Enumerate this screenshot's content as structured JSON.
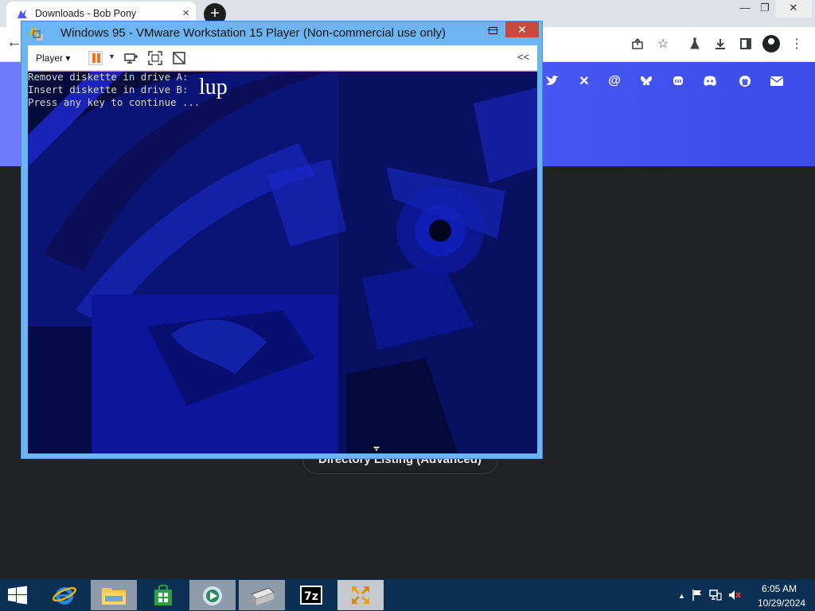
{
  "browser": {
    "tab_title": "Downloads - Bob Pony",
    "tab_close": "×",
    "new_tab": "+",
    "win_min": "—",
    "win_max": "❐",
    "win_close": "✕"
  },
  "site": {
    "directory_listing_label": "Directory Listing (Advanced)",
    "social_icons": [
      "twitter-icon",
      "x-icon",
      "threads-icon",
      "bluesky-icon",
      "mastodon-icon",
      "discord-icon",
      "github-icon",
      "email-icon"
    ]
  },
  "vmware": {
    "title": "Windows 95 - VMware Workstation 15 Player (Non-commercial use only)",
    "player_menu": "Player ▾",
    "collapse": "<<",
    "minimize": "—",
    "close": "✕",
    "boot_lines": [
      "Remove diskette in drive A:",
      "Insert diskette in drive B:",
      "Press any key to continue ..."
    ],
    "overlay_text": "lup"
  },
  "taskbar": {
    "apps": [
      "start-icon",
      "internet-explorer-icon",
      "file-explorer-icon",
      "store-icon",
      "media-player-icon",
      "scanner-icon",
      "7zip-icon",
      "vmware-icon"
    ],
    "tray_up": "▲",
    "time": "6:05 AM",
    "date": "10/29/2024"
  },
  "colors": {
    "vm_frame": "#6bb5f2",
    "header_blue": "#4b5bf6",
    "taskbar": "#0c2f54",
    "close_red": "#c74b3a"
  }
}
